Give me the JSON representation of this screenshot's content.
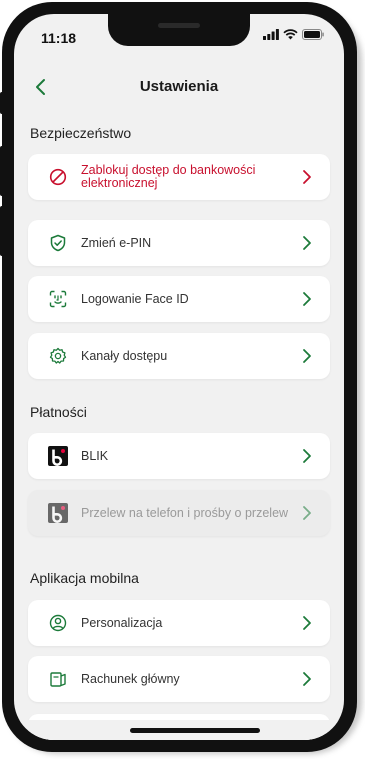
{
  "status_bar": {
    "time": "11:18"
  },
  "nav": {
    "title": "Ustawienia"
  },
  "sections": {
    "security": {
      "title": "Bezpieczeństwo",
      "items": [
        {
          "label": "Zablokuj dostęp do bankowości elektronicznej",
          "icon": "block-icon",
          "style": "danger"
        },
        {
          "label": "Zmień e-PIN",
          "icon": "shield-check-icon"
        },
        {
          "label": "Logowanie Face ID",
          "icon": "face-id-icon"
        },
        {
          "label": "Kanały dostępu",
          "icon": "gear-icon"
        }
      ]
    },
    "payments": {
      "title": "Płatności",
      "items": [
        {
          "label": "BLIK",
          "icon": "blik-icon"
        },
        {
          "label": "Przelew na telefon i prośby o przelew",
          "icon": "blik-icon",
          "style": "disabled"
        }
      ]
    },
    "mobile_app": {
      "title": "Aplikacja mobilna",
      "items": [
        {
          "label": "Personalizacja",
          "icon": "user-circle-icon"
        },
        {
          "label": "Rachunek główny",
          "icon": "account-icon"
        }
      ]
    }
  },
  "colors": {
    "accent_green": "#1c7a3a",
    "danger_red": "#c8102e",
    "background": "#f1f1f1"
  }
}
